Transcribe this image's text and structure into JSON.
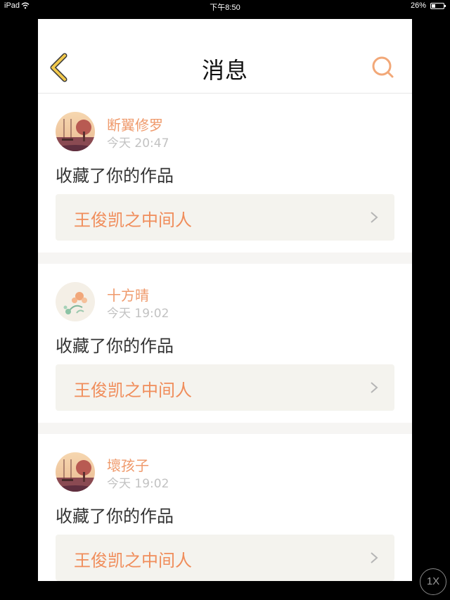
{
  "status_bar": {
    "device": "iPad",
    "time": "下午8:50",
    "battery": "26%"
  },
  "header": {
    "title": "消息",
    "back_icon": "chevron-left-icon",
    "search_icon": "search-icon"
  },
  "messages": [
    {
      "username": "断翼修罗",
      "time": "今天 20:47",
      "action": "收藏了你的作品",
      "work": "王俊凯之中间人",
      "avatar": "avatar-swing-scene"
    },
    {
      "username": "十方晴",
      "time": "今天 19:02",
      "action": "收藏了你的作品",
      "work": "王俊凯之中间人",
      "avatar": "avatar-flowers"
    },
    {
      "username": "壞孩子",
      "time": "今天 19:02",
      "action": "收藏了你的作品",
      "work": "王俊凯之中间人",
      "avatar": "avatar-swing-scene"
    }
  ],
  "zoom_button": "1X",
  "colors": {
    "accent": "#ef9a6c",
    "back_arrow": "#f0c64a",
    "link_background": "#f4f3ee"
  }
}
